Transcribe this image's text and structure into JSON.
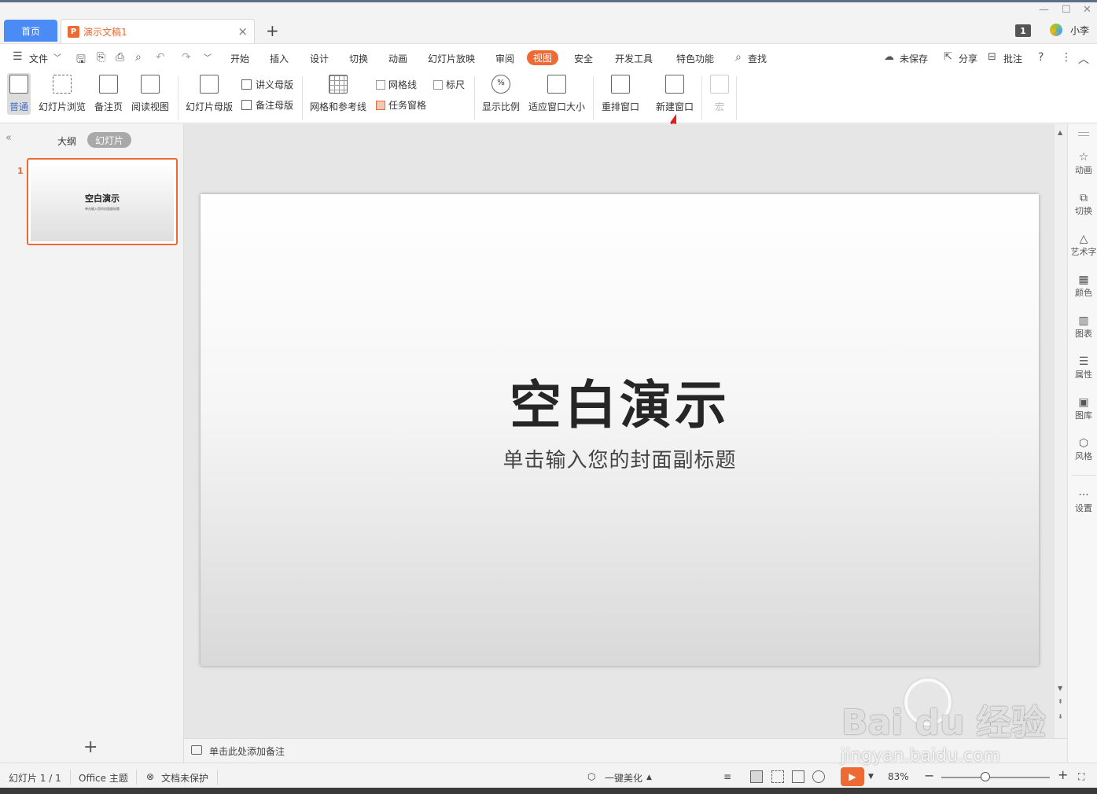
{
  "tabs": {
    "home": "首页",
    "document": "演示文稿1",
    "close_icon": "×",
    "add_icon": "+"
  },
  "window": {
    "badge": "1",
    "user": "小李"
  },
  "menu": {
    "file": "文件",
    "items": [
      "开始",
      "插入",
      "设计",
      "切换",
      "动画",
      "幻灯片放映",
      "审阅",
      "视图",
      "安全",
      "开发工具",
      "特色功能"
    ],
    "active": "视图",
    "search": "查找",
    "unsaved": "未保存",
    "share": "分享",
    "comment": "批注"
  },
  "ribbon": {
    "normal": "普通",
    "slide_sorter": "幻灯片浏览",
    "notes_page": "备注页",
    "reading_view": "阅读视图",
    "slide_master": "幻灯片母版",
    "handout_master": "讲义母版",
    "notes_master": "备注母版",
    "grid_guides": "网格和参考线",
    "gridlines": "网格线",
    "ruler": "标尺",
    "task_pane": "任务窗格",
    "zoom": "显示比例",
    "fit_window": "适应窗口大小",
    "arrange": "重排窗口",
    "new_window": "新建窗口",
    "macro": "宏"
  },
  "panel": {
    "outline": "大纲",
    "slides": "幻灯片",
    "slide_number": "1",
    "add": "+"
  },
  "slide": {
    "title": "空白演示",
    "subtitle": "单击输入您的封面副标题",
    "thumb_title": "空白演示",
    "thumb_subtitle": "单击输入您的封面副标题"
  },
  "notes": {
    "placeholder": "单击此处添加备注"
  },
  "rightbar": [
    "动画",
    "切换",
    "艺术字",
    "颜色",
    "图表",
    "属性",
    "图库",
    "风格",
    "设置"
  ],
  "status": {
    "slide_count": "幻灯片 1 / 1",
    "theme": "Office 主题",
    "protect": "文档未保护",
    "beautify": "一键美化",
    "zoom": "83%"
  },
  "watermark": {
    "brand": "Bai  du 经验",
    "url": "jingyan.baidu.com"
  },
  "colors": {
    "accent": "#ee6a35",
    "home_tab": "#4b8bf5",
    "annotation_arrow": "#e02020"
  }
}
